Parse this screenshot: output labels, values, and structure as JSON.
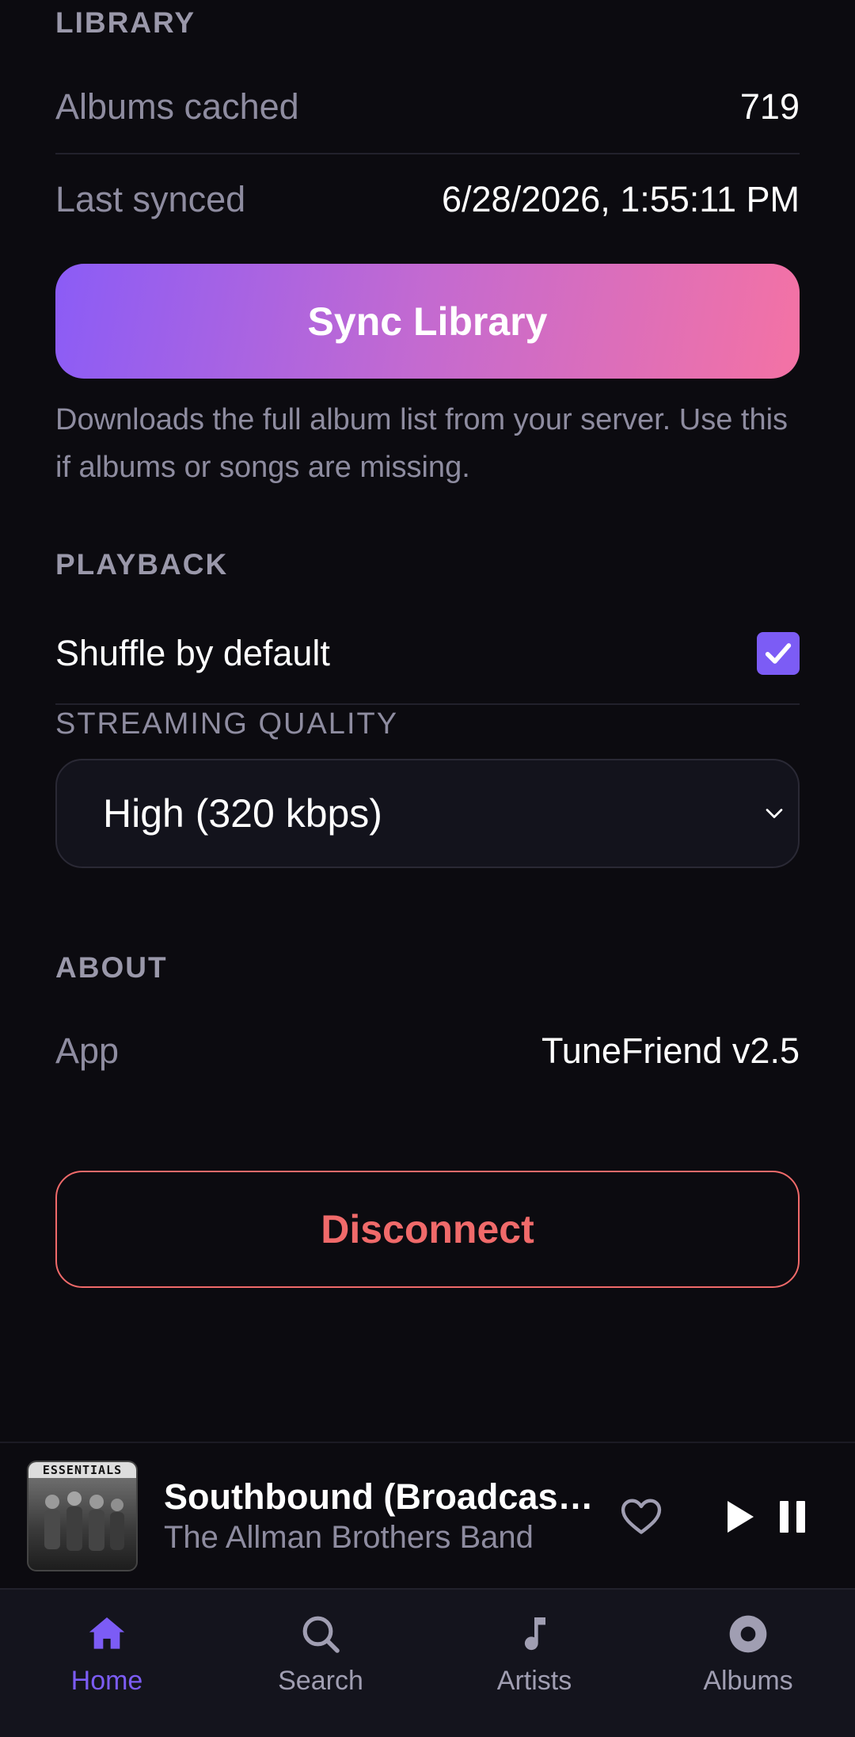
{
  "library": {
    "header": "LIBRARY",
    "albums_cached_label": "Albums cached",
    "albums_cached_value": "719",
    "last_synced_label": "Last synced",
    "last_synced_value": "6/28/2026, 1:55:11 PM",
    "sync_button": "Sync Library",
    "sync_helper": "Downloads the full album list from your server. Use this if albums or songs are missing."
  },
  "playback": {
    "header": "PLAYBACK",
    "shuffle_label": "Shuffle by default",
    "shuffle_checked": true,
    "quality_label": "STREAMING QUALITY",
    "quality_value": "High (320 kbps)"
  },
  "about": {
    "header": "ABOUT",
    "app_label": "App",
    "app_value": "TuneFriend v2.5"
  },
  "disconnect_button": "Disconnect",
  "now_playing": {
    "art_text": "ESSENTIALS",
    "title": "Southbound (Broadcast…",
    "artist": "The Allman Brothers Band"
  },
  "tabs": [
    {
      "label": "Home",
      "icon": "home-icon",
      "active": true
    },
    {
      "label": "Search",
      "icon": "search-icon",
      "active": false
    },
    {
      "label": "Artists",
      "icon": "music-note-icon",
      "active": false
    },
    {
      "label": "Albums",
      "icon": "disc-icon",
      "active": false
    }
  ],
  "colors": {
    "background": "#0c0b10",
    "accent": "#7c5cf5",
    "danger": "#f06a6a",
    "gradient_start": "#8b5cf6",
    "gradient_end": "#f472a4"
  }
}
